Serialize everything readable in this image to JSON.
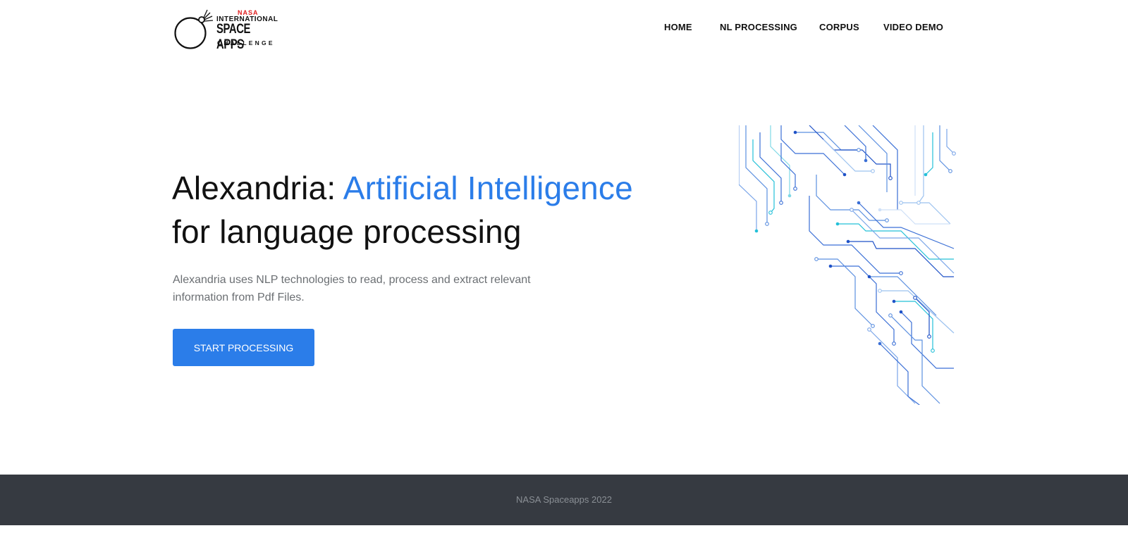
{
  "logo": {
    "nasa": "NASA",
    "line1": "INTERNATIONAL",
    "line2": "SPACE APPS",
    "line3": "CHALLENGE"
  },
  "nav": {
    "items": [
      {
        "label": "HOME"
      },
      {
        "label": "NL PROCESSING"
      },
      {
        "label": "CORPUS"
      },
      {
        "label": "VIDEO DEMO"
      }
    ]
  },
  "hero": {
    "title_part1": "Alexandria: ",
    "title_highlight": "Artificial Intelligence",
    "title_line2": "for language processing",
    "description": "Alexandria uses NLP technologies to read, process and extract relevant information from Pdf Files.",
    "cta_label": "START PROCESSING",
    "image_icon": "circuit-illustration"
  },
  "footer": {
    "text": "NASA Spaceapps 2022"
  },
  "colors": {
    "accent": "#2b7de9",
    "footer_bg": "#363a41",
    "footer_text": "#8a8f95",
    "body_text": "#6b6f73"
  }
}
